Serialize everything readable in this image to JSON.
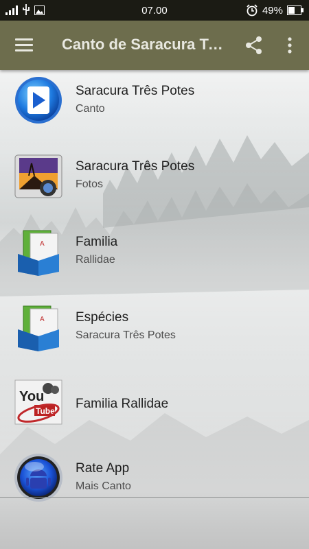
{
  "status_bar": {
    "time": "07.00",
    "battery": "49%",
    "icons": [
      "signal-icon",
      "usb-icon",
      "image-icon",
      "alarm-icon",
      "battery-icon"
    ]
  },
  "toolbar": {
    "title": "Canto de Saracura Três Potes",
    "menu_icon": "hamburger-menu-icon",
    "share_icon": "share-icon",
    "more_icon": "more-vertical-icon",
    "background": "#6d6d4d"
  },
  "items": [
    {
      "label": "Saracura Três Potes",
      "sub": "Canto",
      "icon": "play-button-icon"
    },
    {
      "label": "Saracura Três Potes",
      "sub": "Fotos",
      "icon": "photo-gallery-icon"
    },
    {
      "label": "Familia",
      "sub": "Rallidae",
      "icon": "folders-icon"
    },
    {
      "label": "Espécies",
      "sub": "Saracura Três Potes",
      "icon": "folders-icon"
    },
    {
      "label": "Familia Rallidae",
      "sub": "",
      "icon": "youtube-stamp-icon"
    },
    {
      "label": "Rate App",
      "sub": "Mais Canto",
      "icon": "android-orb-icon"
    }
  ],
  "youtube_icon_text": {
    "you": "You",
    "tube": "Tube"
  }
}
